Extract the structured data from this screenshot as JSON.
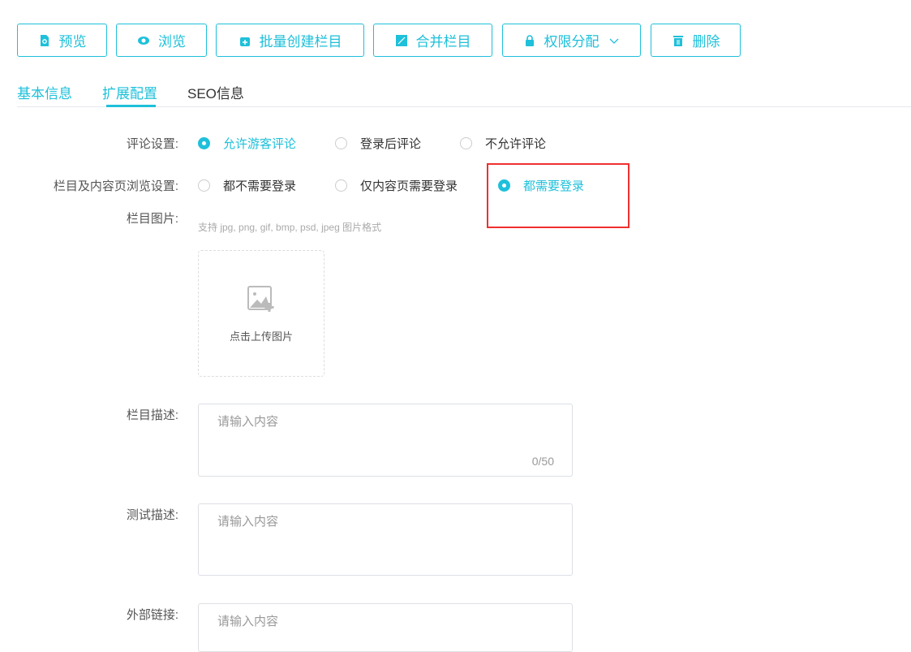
{
  "toolbar": {
    "preview": "预览",
    "browse": "浏览",
    "batch_create": "批量创建栏目",
    "merge": "合并栏目",
    "permission": "权限分配",
    "delete": "删除"
  },
  "tabs": [
    "基本信息",
    "扩展配置",
    "SEO信息"
  ],
  "comment": {
    "label": "评论设置:",
    "options": [
      "允许游客评论",
      "登录后评论",
      "不允许评论"
    ],
    "selected": 0
  },
  "browse_setting": {
    "label": "栏目及内容页浏览设置:",
    "options": [
      "都不需要登录",
      "仅内容页需要登录",
      "都需要登录"
    ],
    "selected": 2
  },
  "image": {
    "label": "栏目图片:",
    "hint": "支持 jpg, png, gif, bmp, psd, jpeg 图片格式",
    "upload": "点击上传图片"
  },
  "desc": {
    "label": "栏目描述:",
    "placeholder": "请输入内容",
    "count": "0/50"
  },
  "test_desc": {
    "label": "测试描述:",
    "placeholder": "请输入内容"
  },
  "external": {
    "label": "外部链接:",
    "placeholder": "请输入内容"
  },
  "colors": {
    "accent": "#1ec0da",
    "highlight": "#f03030"
  }
}
